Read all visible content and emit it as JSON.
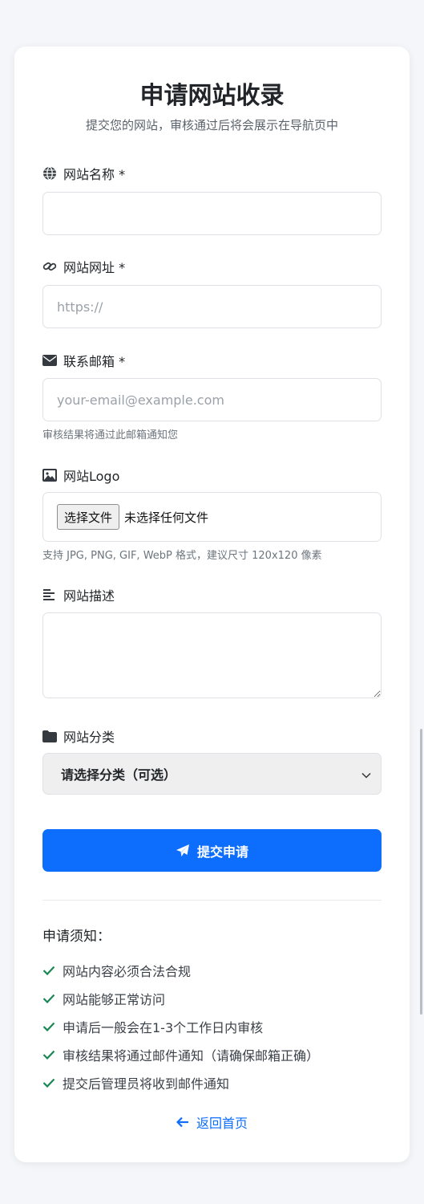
{
  "header": {
    "title": "申请网站收录",
    "subtitle": "提交您的网站，审核通过后将会展示在导航页中"
  },
  "form": {
    "site_name": {
      "label": "网站名称 *",
      "value": "",
      "icon": "globe-icon"
    },
    "site_url": {
      "label": "网站网址 *",
      "placeholder": "https://",
      "icon": "link-icon"
    },
    "email": {
      "label": "联系邮箱 *",
      "placeholder": "your-email@example.com",
      "hint": "审核结果将通过此邮箱通知您",
      "icon": "envelope-icon"
    },
    "logo": {
      "label": "网站Logo",
      "button_label": "选择文件",
      "status": "未选择任何文件",
      "hint": "支持 JPG, PNG, GIF, WebP 格式，建议尺寸 120x120 像素",
      "icon": "image-icon"
    },
    "description": {
      "label": "网站描述",
      "value": "",
      "icon": "align-left-icon"
    },
    "category": {
      "label": "网站分类",
      "selected": "请选择分类（可选）",
      "icon": "folder-icon"
    },
    "submit_label": "提交申请"
  },
  "notes": {
    "title": "申请须知：",
    "items": [
      "网站内容必须合法合规",
      "网站能够正常访问",
      "申请后一般会在1-3个工作日内审核",
      "审核结果将通过邮件通知（请确保邮箱正确）",
      "提交后管理员将收到邮件通知"
    ]
  },
  "back_link": "返回首页",
  "colors": {
    "primary": "#0d6efd",
    "check": "#198754",
    "background": "#f4f6f9"
  }
}
